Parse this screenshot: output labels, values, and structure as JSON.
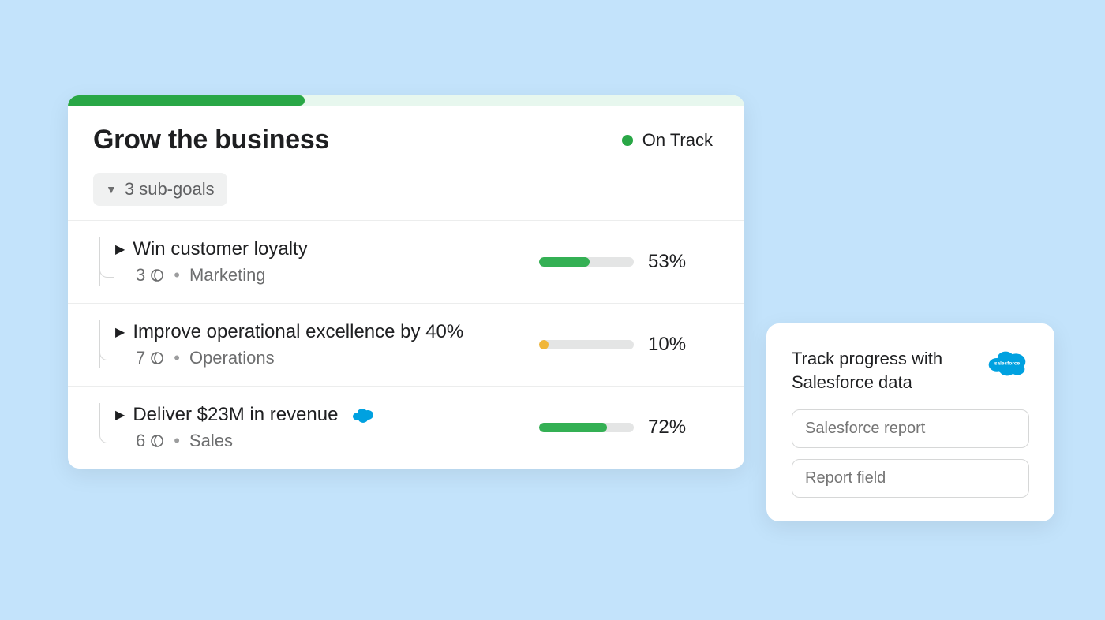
{
  "main": {
    "title": "Grow the business",
    "progress_percent": 35,
    "status": {
      "label": "On Track",
      "color": "#29a746"
    },
    "subgoals_chip": "3 sub-goals",
    "goals": [
      {
        "title": "Win customer loyalty",
        "count": "3",
        "department": "Marketing",
        "percent_label": "53%",
        "percent": 53,
        "bar_color": "green",
        "has_salesforce": false
      },
      {
        "title": "Improve operational excellence by 40%",
        "count": "7",
        "department": "Operations",
        "percent_label": "10%",
        "percent": 10,
        "bar_color": "amber",
        "has_salesforce": false
      },
      {
        "title": "Deliver $23M in revenue",
        "count": "6",
        "department": "Sales",
        "percent_label": "72%",
        "percent": 72,
        "bar_color": "green",
        "has_salesforce": true
      }
    ]
  },
  "side": {
    "title": "Track progress with Salesforce data",
    "input1_placeholder": "Salesforce report",
    "input2_placeholder": "Report field"
  }
}
